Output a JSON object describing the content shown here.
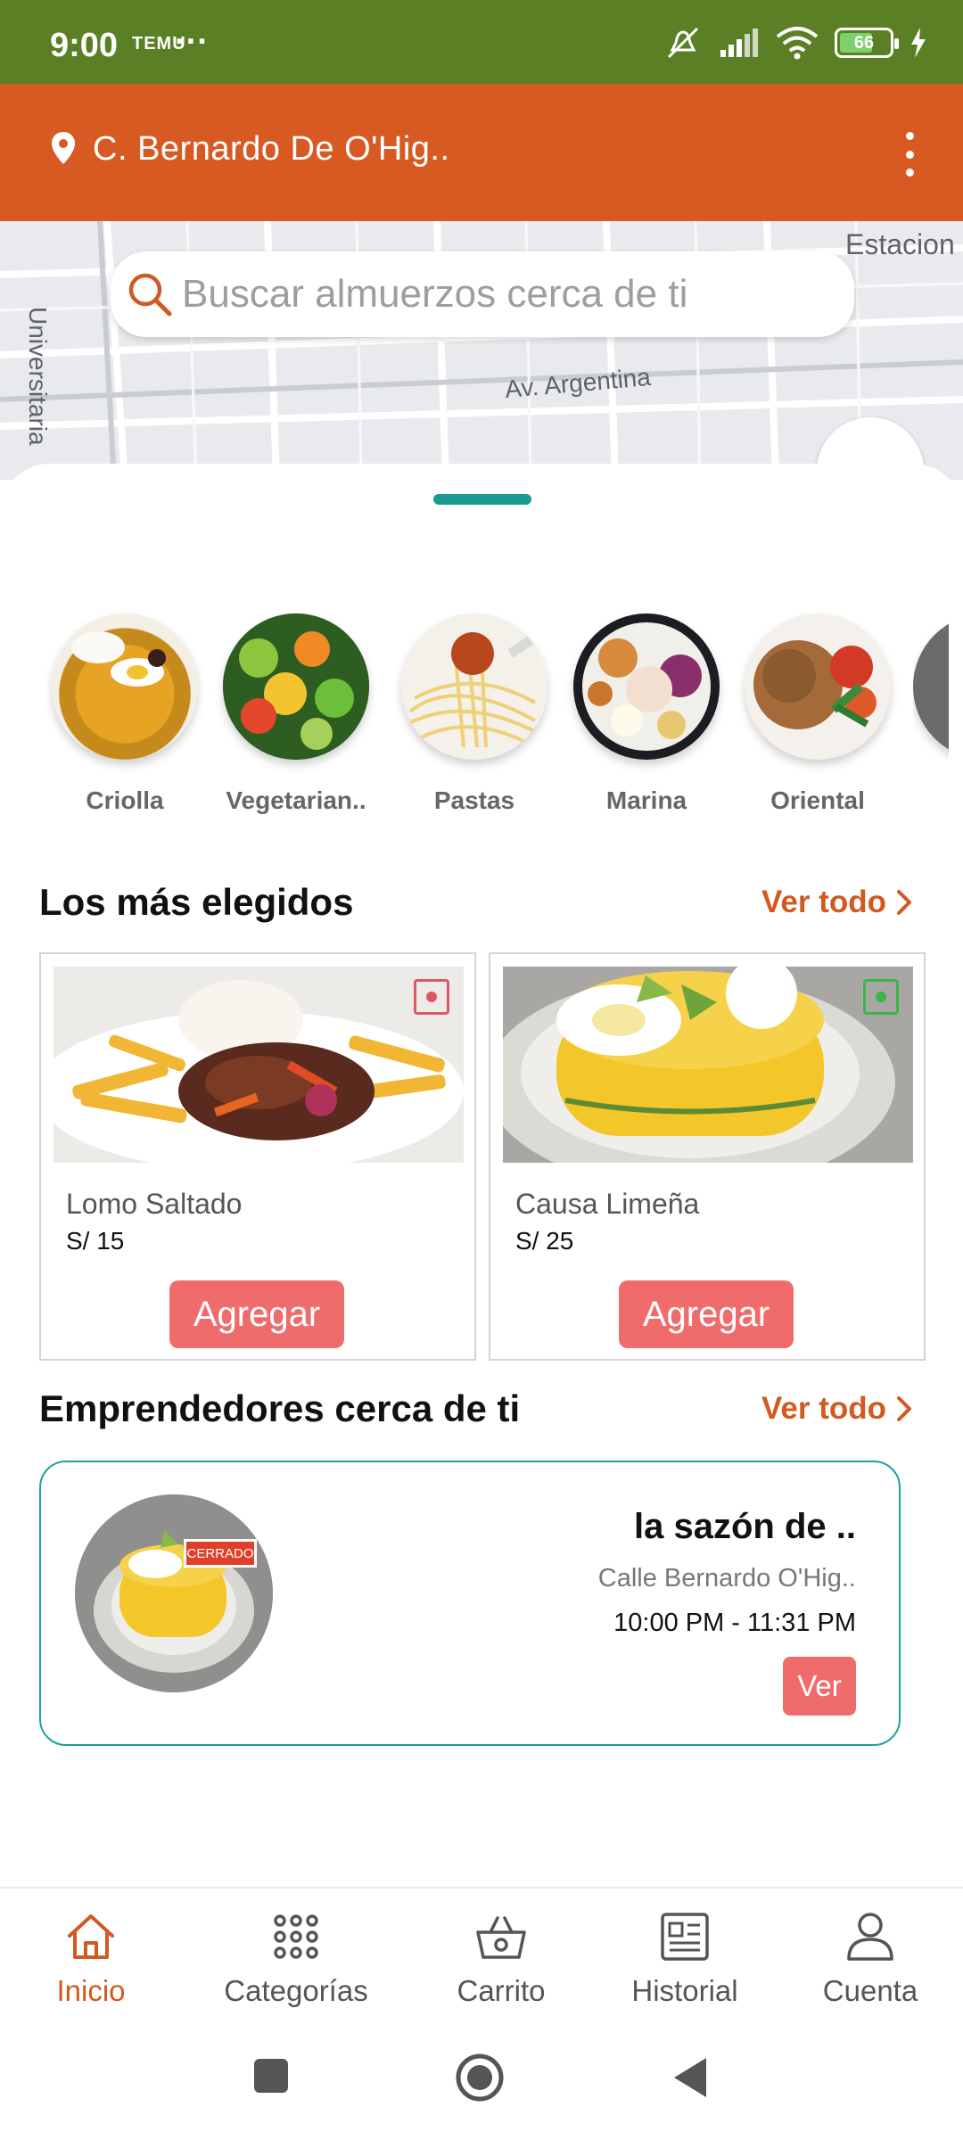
{
  "status_bar": {
    "time": "9:00",
    "notification_text": "TEMU",
    "more": "···",
    "battery": "66"
  },
  "header": {
    "address": "C. Bernardo De O'Hig..",
    "pin_icon": "location-pin-icon",
    "menu_icon": "more-vert-icon"
  },
  "map": {
    "streets": [
      "Universitaria",
      "Av. Argentina",
      "Estacion"
    ]
  },
  "search": {
    "placeholder": "Buscar almuerzos cerca de ti"
  },
  "categories": [
    {
      "label": "Criolla"
    },
    {
      "label": "Vegetarian.."
    },
    {
      "label": "Pastas"
    },
    {
      "label": "Marina"
    },
    {
      "label": "Oriental"
    }
  ],
  "popular": {
    "title": "Los más elegidos",
    "see_all": "Ver todo",
    "items": [
      {
        "name": "Lomo Saltado",
        "price": "S/ 15",
        "button": "Agregar",
        "marker_color": "#e05567"
      },
      {
        "name": "Causa Limeña",
        "price": "S/ 25",
        "button": "Agregar",
        "marker_color": "#3cb44a"
      }
    ]
  },
  "vendors": {
    "title": "Emprendedores cerca de ti",
    "see_all": "Ver todo",
    "items": [
      {
        "name": "la sazón de ..",
        "address": "Calle Bernardo O'Hig..",
        "hours": "10:00 PM - 11:31 PM",
        "status": "CERRADO",
        "button": "Ver"
      }
    ]
  },
  "nav": [
    {
      "label": "Inicio",
      "icon": "home-icon",
      "active": true
    },
    {
      "label": "Categorías",
      "icon": "grid-dots-icon",
      "active": false
    },
    {
      "label": "Carrito",
      "icon": "basket-icon",
      "active": false
    },
    {
      "label": "Historial",
      "icon": "newspaper-icon",
      "active": false
    },
    {
      "label": "Cuenta",
      "icon": "person-icon",
      "active": false
    }
  ],
  "colors": {
    "status_bar": "#5a7f24",
    "header": "#d85a23",
    "accent": "#d05a1f",
    "button": "#f06c6c",
    "teal": "#1aa3a0"
  }
}
